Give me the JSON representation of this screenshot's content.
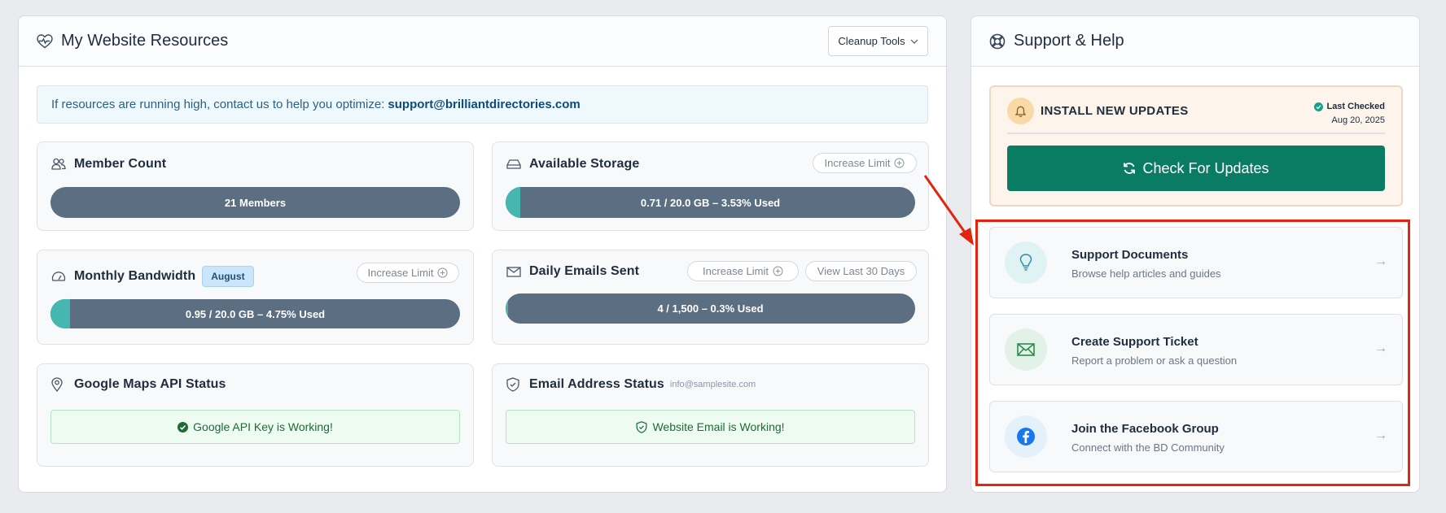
{
  "left_panel": {
    "title": "My Website Resources",
    "cleanup_label": "Cleanup Tools",
    "banner_text": "If resources are running high, contact us to help you optimize:",
    "banner_email": "support@brilliantdirectories.com"
  },
  "member_count": {
    "title": "Member Count",
    "bar_text": "21 Members"
  },
  "storage": {
    "title": "Available Storage",
    "increase_label": "Increase Limit",
    "bar_text": "0.71 / 20.0 GB – 3.53% Used",
    "percent": 3.53
  },
  "bandwidth": {
    "title": "Monthly Bandwidth",
    "month": "August",
    "increase_label": "Increase Limit",
    "bar_text": "0.95 / 20.0 GB – 4.75% Used",
    "percent": 4.75
  },
  "emails": {
    "title": "Daily Emails Sent",
    "increase_label": "Increase Limit",
    "view_label": "View Last 30 Days",
    "bar_text": "4 / 1,500 – 0.3% Used",
    "percent": 0.3
  },
  "maps": {
    "title": "Google Maps API Status",
    "status": "Google API Key is Working!"
  },
  "email_status": {
    "title": "Email Address Status",
    "address": "info@samplesite.com",
    "status": "Website Email is Working!"
  },
  "right_panel": {
    "title": "Support & Help",
    "updates_title": "INSTALL NEW UPDATES",
    "last_checked_label": "Last Checked",
    "last_checked_date": "Aug 20, 2025",
    "check_button": "Check For Updates"
  },
  "help_items": [
    {
      "title": "Support Documents",
      "subtitle": "Browse help articles and guides",
      "icon": "lightbulb-icon"
    },
    {
      "title": "Create Support Ticket",
      "subtitle": "Report a problem or ask a question",
      "icon": "envelope-icon"
    },
    {
      "title": "Join the Facebook Group",
      "subtitle": "Connect with the BD Community",
      "icon": "facebook-icon"
    }
  ],
  "colors": {
    "bar": "#5b6e82",
    "fill": "#45b6b0",
    "primary_button": "#0a7c63",
    "annotation": "#e3240f"
  }
}
